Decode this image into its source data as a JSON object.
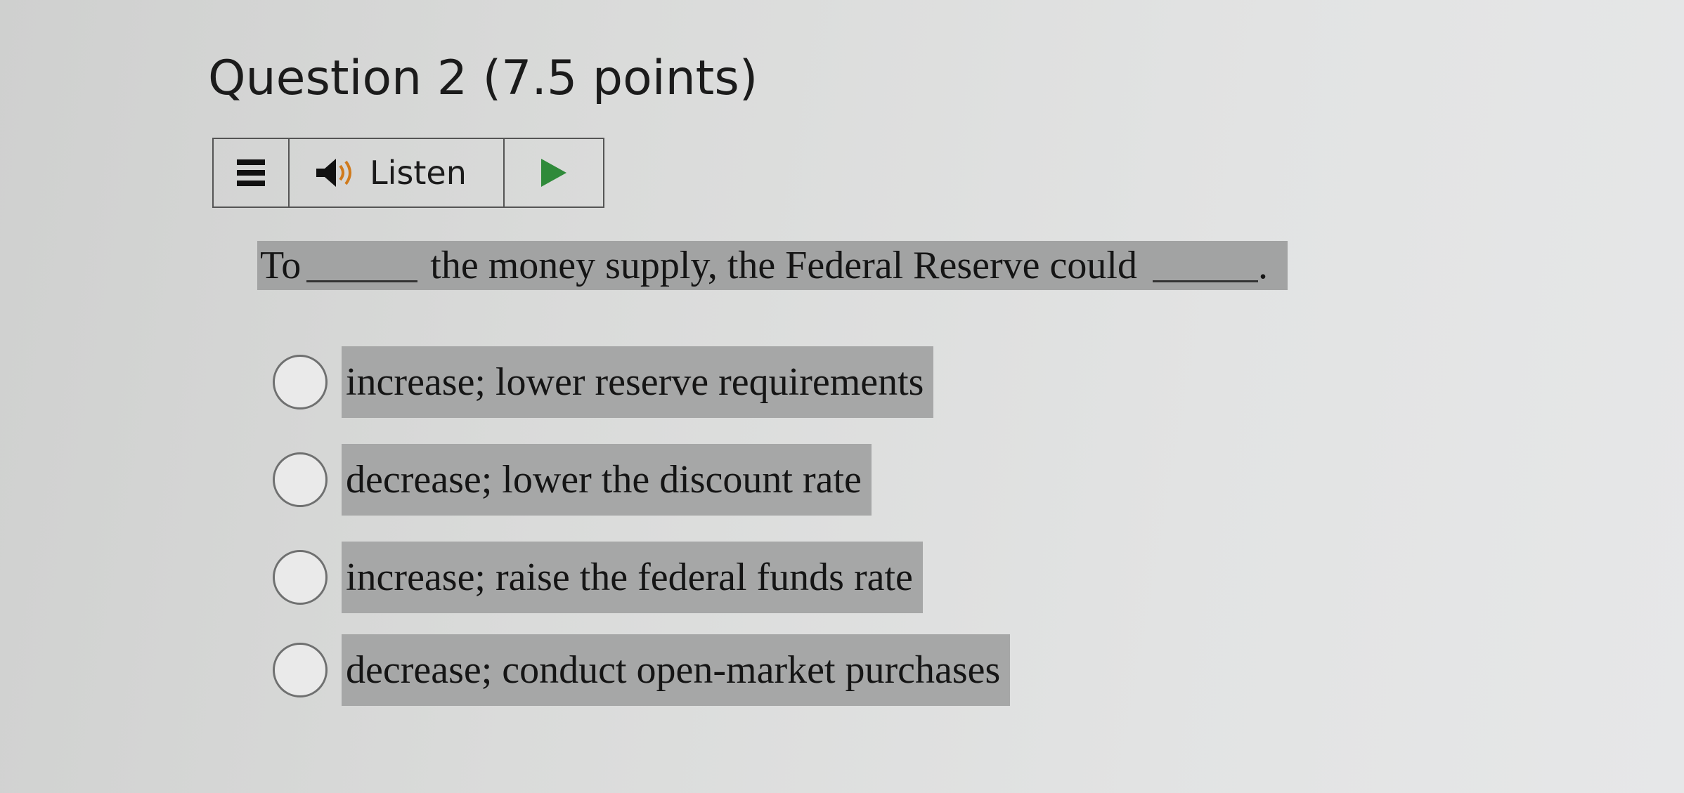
{
  "question": {
    "title": "Question 2 (7.5 points)"
  },
  "toolbar": {
    "listen_label": "Listen",
    "icons": [
      "menu-icon",
      "speaker-icon",
      "play-icon"
    ],
    "play_color": "#2f8a3a"
  },
  "stem": {
    "part1": "To",
    "part2": "the money supply, the Federal Reserve could",
    "part3": "."
  },
  "options": [
    {
      "label": "increase; lower reserve requirements",
      "selected": false
    },
    {
      "label": "decrease; lower the discount rate",
      "selected": false
    },
    {
      "label": "increase; raise the federal funds rate",
      "selected": false
    },
    {
      "label": "decrease; conduct open-market purchases",
      "selected": false
    }
  ]
}
